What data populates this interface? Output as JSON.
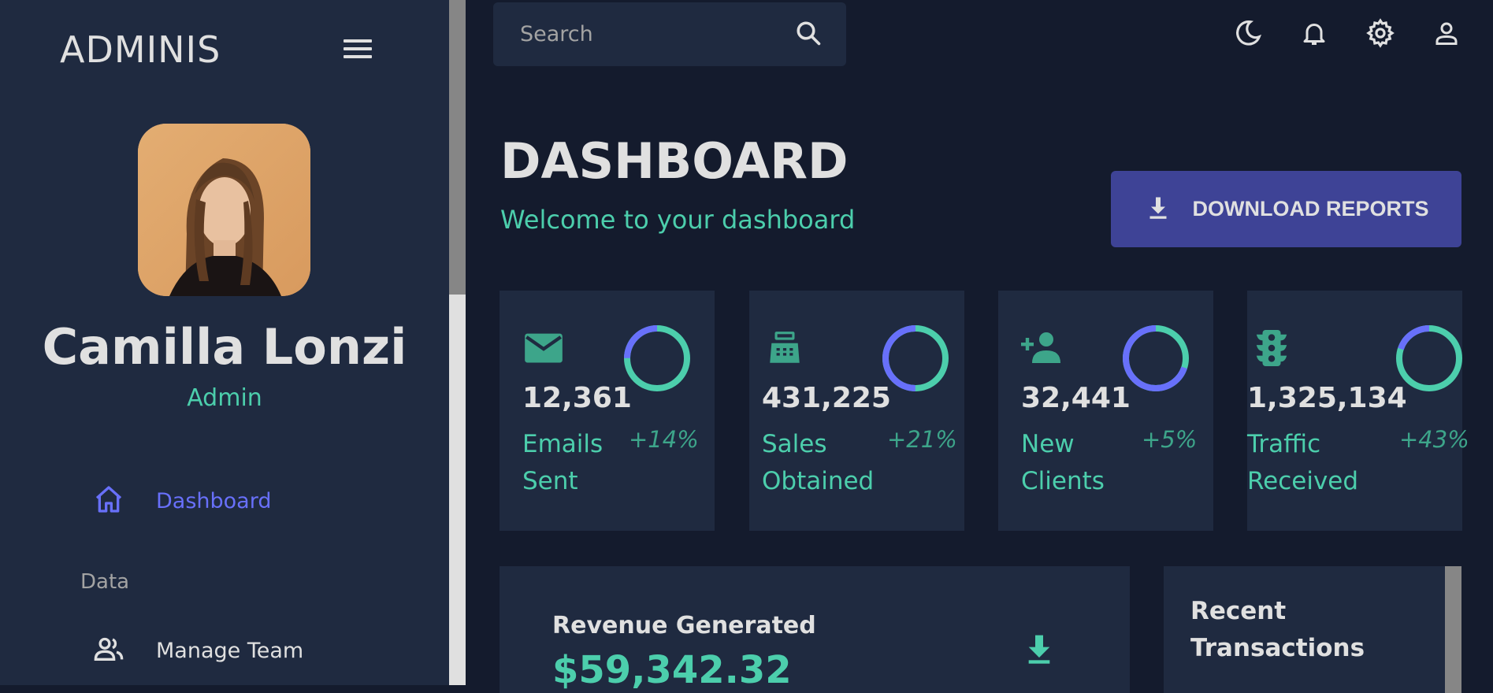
{
  "sidebar": {
    "brand": "ADMINIS",
    "profile": {
      "name": "Camilla Lonzi",
      "role": "Admin"
    },
    "items": [
      {
        "label": "Dashboard",
        "icon": "home-icon",
        "active": true
      },
      {
        "label": "Manage Team",
        "icon": "people-icon",
        "active": false
      }
    ],
    "section_data": "Data"
  },
  "topbar": {
    "search_placeholder": "Search",
    "icons": [
      "moon-icon",
      "bell-icon",
      "gear-icon",
      "person-icon"
    ]
  },
  "header": {
    "title": "DASHBOARD",
    "subtitle": "Welcome to your dashboard",
    "download_label": "DOWNLOAD REPORTS"
  },
  "stats": [
    {
      "value": "12,361",
      "title": "Emails Sent",
      "increase": "+14%",
      "progress": 0.75,
      "icon": "email-icon"
    },
    {
      "value": "431,225",
      "title": "Sales Obtained",
      "increase": "+21%",
      "progress": 0.5,
      "icon": "point-of-sale-icon"
    },
    {
      "value": "32,441",
      "title": "New Clients",
      "increase": "+5%",
      "progress": 0.3,
      "icon": "person-add-icon"
    },
    {
      "value": "1,325,134",
      "title": "Traffic Received",
      "increase": "+43%",
      "progress": 0.8,
      "icon": "traffic-icon"
    }
  ],
  "revenue": {
    "title": "Revenue Generated",
    "amount": "$59,342.32"
  },
  "transactions": {
    "title": "Recent Transactions"
  },
  "colors": {
    "background": "#141b2d",
    "panel": "#1f2a40",
    "accent_green": "#4cceac",
    "accent_blue": "#6870fa",
    "button": "#3e4396",
    "text": "#e0e0e0"
  }
}
